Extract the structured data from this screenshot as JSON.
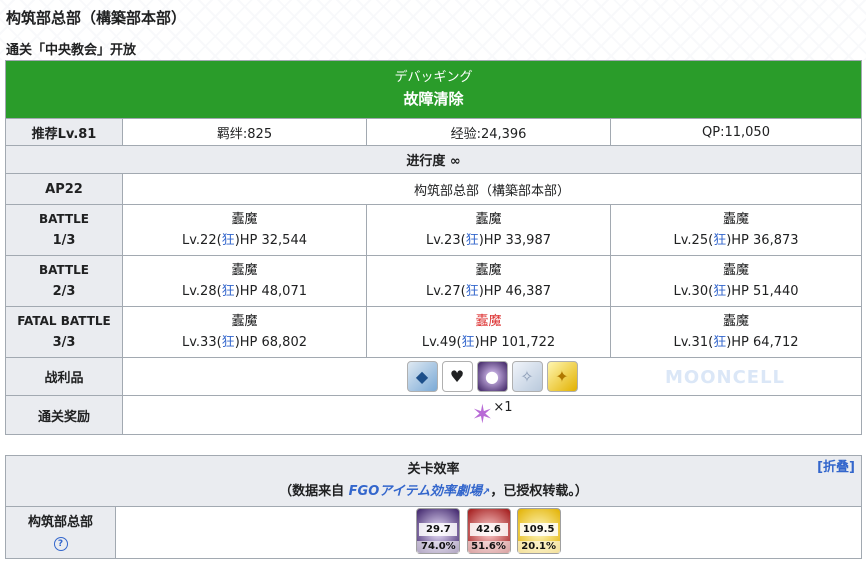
{
  "page_title": "构筑部总部（構築部本部）",
  "unlock_condition": "通关「中央教会」开放",
  "quest": {
    "name_jp": "デバッギング",
    "name_cn": "故障清除",
    "recommended": "推荐Lv.81",
    "bond": "羁绊:825",
    "exp": "经验:24,396",
    "qp": "QP:11,050",
    "progress": "进行度 ∞",
    "ap": "AP22",
    "location": "构筑部总部（構築部本部）",
    "battles": [
      {
        "label": "BATTLE",
        "num": "1/3",
        "enemies": [
          {
            "name": "蠹魔",
            "lv": "Lv.22(",
            "cls": "狂",
            "hp": ")HP 32,544"
          },
          {
            "name": "蠹魔",
            "lv": "Lv.23(",
            "cls": "狂",
            "hp": ")HP 33,987"
          },
          {
            "name": "蠹魔",
            "lv": "Lv.25(",
            "cls": "狂",
            "hp": ")HP 36,873"
          }
        ]
      },
      {
        "label": "BATTLE",
        "num": "2/3",
        "enemies": [
          {
            "name": "蠹魔",
            "lv": "Lv.28(",
            "cls": "狂",
            "hp": ")HP 48,071"
          },
          {
            "name": "蠹魔",
            "lv": "Lv.27(",
            "cls": "狂",
            "hp": ")HP 46,387"
          },
          {
            "name": "蠹魔",
            "lv": "Lv.30(",
            "cls": "狂",
            "hp": ")HP 51,440"
          }
        ]
      },
      {
        "label": "FATAL BATTLE",
        "num": "3/3",
        "enemies": [
          {
            "name": "蠹魔",
            "lv": "Lv.33(",
            "cls": "狂",
            "hp": ")HP 68,802"
          },
          {
            "name": "蠹魔",
            "lv": "Lv.49(",
            "cls": "狂",
            "hp": ")HP 101,722"
          },
          {
            "name": "蠹魔",
            "lv": "Lv.31(",
            "cls": "狂",
            "hp": ")HP 64,712"
          }
        ]
      }
    ],
    "drops_label": "战利品",
    "reward_label": "通关奖励",
    "reward_count": "×1"
  },
  "watermark": "MOONCELL",
  "efficiency": {
    "title": "关卡效率",
    "collapse": "[折叠]",
    "source_prefix": "（数据来自 ",
    "source_link": "FGOアイテム効率劇場",
    "source_suffix": "，已授权转载。）",
    "row_label": "构筑部总部",
    "help": "?",
    "items": [
      {
        "value": "29.7",
        "pct": "74.0%"
      },
      {
        "value": "42.6",
        "pct": "51.6%"
      },
      {
        "value": "109.5",
        "pct": "20.1%"
      }
    ]
  },
  "colors": {
    "header_green": "#2a9c2a",
    "link_blue": "#3366cc",
    "boss_red": "#dd3333"
  }
}
